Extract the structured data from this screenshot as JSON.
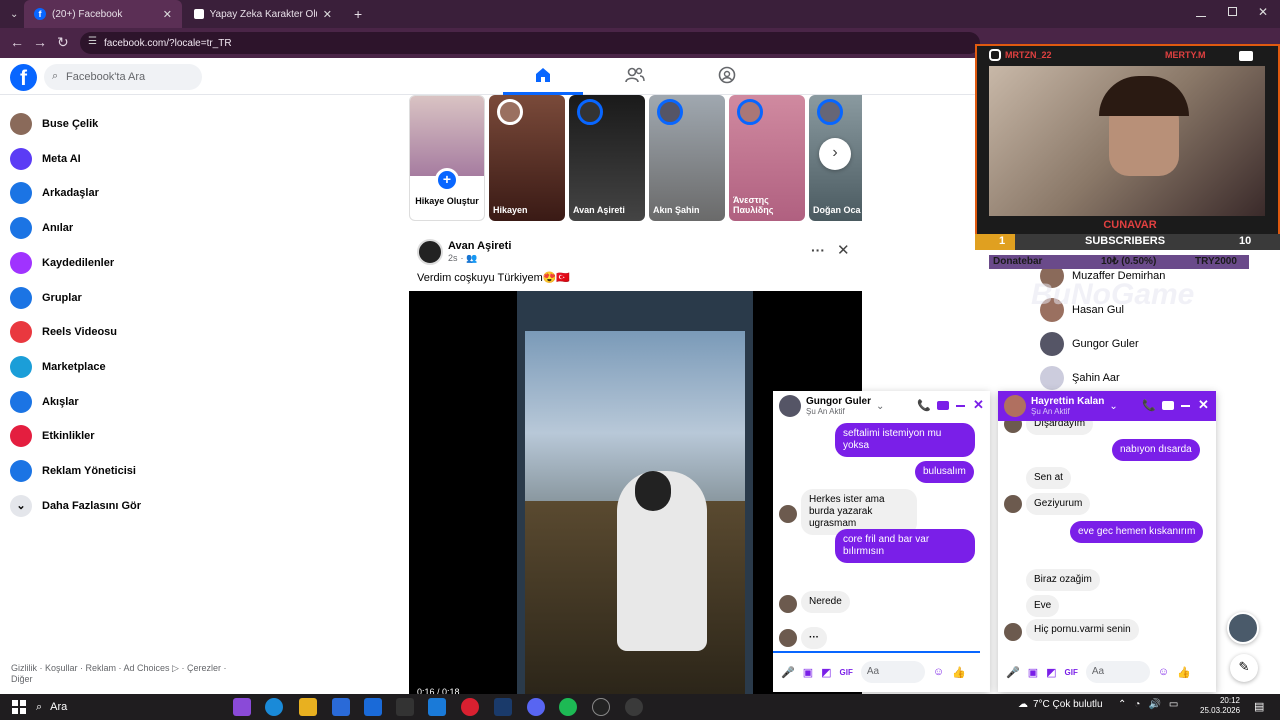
{
  "browser": {
    "tabs": [
      {
        "label": "(20+) Facebook"
      },
      {
        "label": "Yapay Zeka Karakter Oluşturuc..."
      }
    ],
    "url": "facebook.com/?locale=tr_TR"
  },
  "header": {
    "search_placeholder": "Facebook'ta Ara"
  },
  "sidebar": {
    "items": [
      {
        "label": "Buse Çelik",
        "icon": "avatar",
        "color": "#8a6a5a"
      },
      {
        "label": "Meta AI",
        "icon": "meta-ai-icon",
        "color": "#5b3cf5"
      },
      {
        "label": "Arkadaşlar",
        "icon": "friends-icon",
        "color": "#1b74e4"
      },
      {
        "label": "Anılar",
        "icon": "memories-icon",
        "color": "#1b74e4"
      },
      {
        "label": "Kaydedilenler",
        "icon": "bookmark-icon",
        "color": "#a033ff"
      },
      {
        "label": "Gruplar",
        "icon": "groups-icon",
        "color": "#1b74e4"
      },
      {
        "label": "Reels Videosu",
        "icon": "reels-icon",
        "color": "#e9383f"
      },
      {
        "label": "Marketplace",
        "icon": "marketplace-icon",
        "color": "#1b9ed8"
      },
      {
        "label": "Akışlar",
        "icon": "feeds-icon",
        "color": "#1b74e4"
      },
      {
        "label": "Etkinlikler",
        "icon": "events-icon",
        "color": "#e41e3f"
      },
      {
        "label": "Reklam Yöneticisi",
        "icon": "ads-manager-icon",
        "color": "#1b74e4"
      },
      {
        "label": "Daha Fazlasını Gör",
        "icon": "chevron-down-icon",
        "color": "#e4e6eb"
      }
    ],
    "footer": "Gizlilik · Koşullar · Reklam · Ad Choices ▷ · Çerezler · Diğer"
  },
  "stories": [
    {
      "label": "Hikaye Oluştur"
    },
    {
      "label": "Hikayen"
    },
    {
      "label": "Avan Aşireti"
    },
    {
      "label": "Akın Şahin"
    },
    {
      "label": "Άνεστης Παυλίδης"
    },
    {
      "label": "Doğan Oca"
    }
  ],
  "post": {
    "author": "Avan Aşireti",
    "time": "2s",
    "text": "Verdim coşkuyu Türkiyem😍🇹🇷",
    "video_time": "0:16 / 0:18"
  },
  "contacts": [
    {
      "name": "Muzaffer Demirhan"
    },
    {
      "name": "Hasan Gul"
    },
    {
      "name": "Gungor Guler"
    },
    {
      "name": "Şahin Aar"
    }
  ],
  "chat1": {
    "name": "Gungor Guler",
    "status": "Şu An Aktif",
    "messages": [
      {
        "dir": "out",
        "text": "seftalimi istemiyon mu yoksa"
      },
      {
        "dir": "out",
        "text": "bulusalım"
      },
      {
        "dir": "in",
        "text": "Herkes ister ama burda yazarak ugrasmam"
      },
      {
        "dir": "out",
        "text": "core fril and bar var bılırmısın"
      },
      {
        "dir": "in",
        "text": "Nerede"
      },
      {
        "dir": "in",
        "text": "···"
      }
    ],
    "input_placeholder": "Aa"
  },
  "chat2": {
    "name": "Hayrettin Kalan",
    "status": "Şu An Aktif",
    "messages": [
      {
        "dir": "in",
        "text": "Dışardayım"
      },
      {
        "dir": "out",
        "text": "nabıyon dısarda"
      },
      {
        "dir": "in",
        "text": "Sen at"
      },
      {
        "dir": "in",
        "text": "Geziyurum"
      },
      {
        "dir": "out",
        "text": "eve gec hemen kıskanırım"
      },
      {
        "dir": "in",
        "text": "Biraz ozağim"
      },
      {
        "dir": "in",
        "text": "Eve"
      },
      {
        "dir": "in",
        "text": "Hiç pornu.varmi senin"
      }
    ],
    "input_placeholder": "Aa"
  },
  "overlay": {
    "instagram": "MRTZN_22",
    "youtube": "MERTY.M",
    "streamer": "CUNAVAR",
    "subs_left": "1",
    "subs_label": "SUBSCRIBERS",
    "subs_right": "10",
    "donate_label": "Donatebar",
    "donate_progress": "10₺ (0.50%)",
    "donate_goal": "TRY2000",
    "watermark": "BuNoGame"
  },
  "taskbar": {
    "search": "Ara",
    "weather": "7°C  Çok bulutlu",
    "time": "20:12",
    "date": "25.03.2026"
  }
}
